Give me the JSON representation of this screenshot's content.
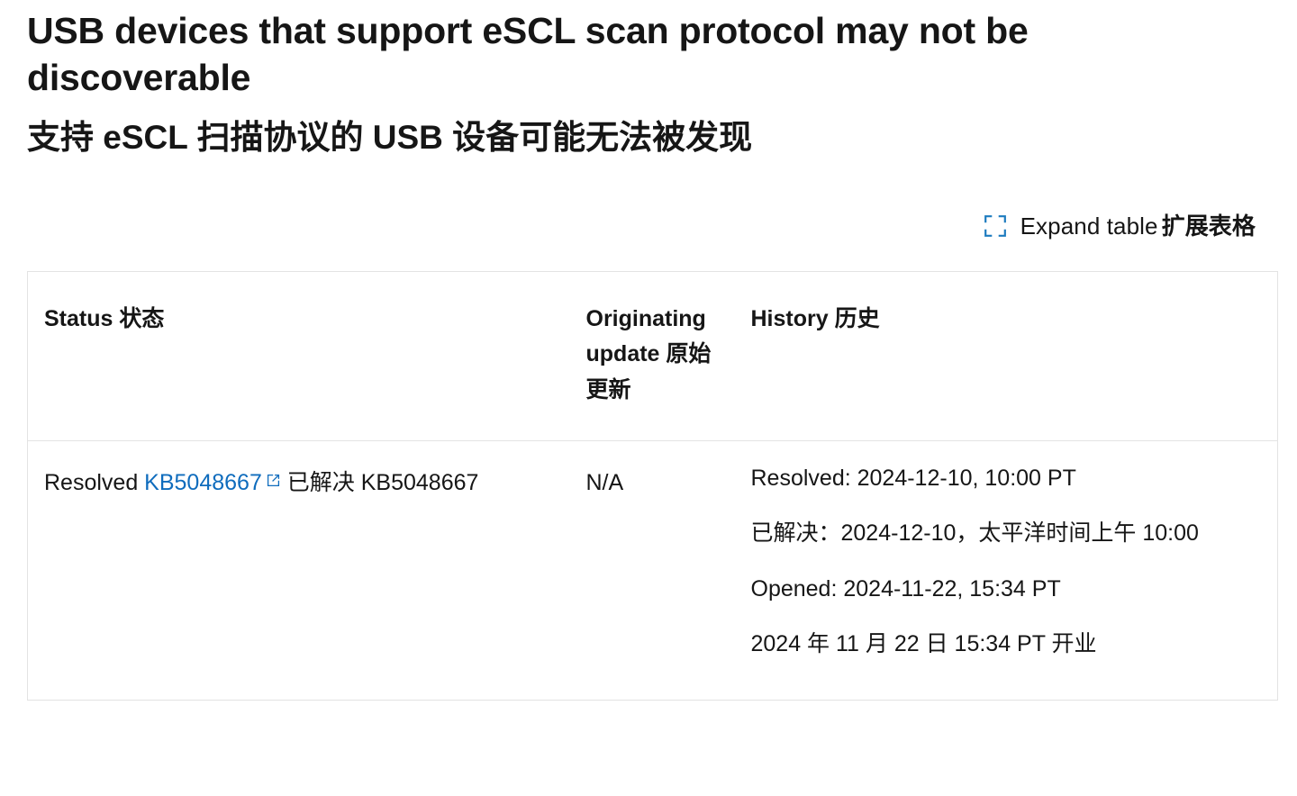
{
  "page": {
    "title_en": "USB devices that support eSCL scan protocol may not be discoverable",
    "title_zh": "支持 eSCL 扫描协议的 USB 设备可能无法被发现"
  },
  "expand_control": {
    "icon": "expand-table-icon",
    "label_en": "Expand table",
    "label_zh": "扩展表格",
    "icon_color": "#1d7bbf"
  },
  "table": {
    "headers": [
      "Status 状态",
      "Originating update 原始更新",
      "History 历史"
    ],
    "rows": [
      {
        "status": {
          "prefix": "Resolved ",
          "link_text": "KB5048667",
          "link_icon": "external-link-icon",
          "suffix": " 已解决 KB5048667"
        },
        "originating_update": "N/A",
        "history": [
          "Resolved: 2024-12-10, 10:00 PT",
          "已解决：2024-12-10，太平洋时间上午 10:00",
          "Opened: 2024-11-22, 15:34 PT",
          "2024 年 11 月 22 日 15:34 PT 开业"
        ]
      }
    ]
  },
  "colors": {
    "link": "#0f6cbd",
    "text": "#161616",
    "border": "#e3e3e3"
  }
}
